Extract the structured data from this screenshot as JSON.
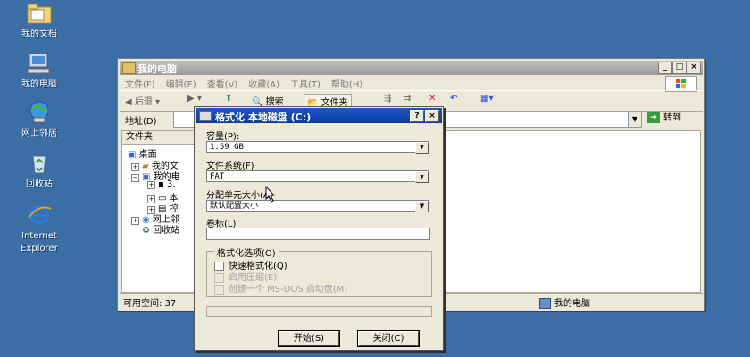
{
  "desktop": {
    "icons": [
      {
        "label": "我的文档"
      },
      {
        "label": "我的电脑"
      },
      {
        "label": "网上邻居"
      },
      {
        "label": "回收站"
      },
      {
        "label": "Internet\nExplorer"
      }
    ]
  },
  "explorer": {
    "title": "我的电脑",
    "menu": [
      "文件(F)",
      "编辑(E)",
      "查看(V)",
      "收藏(A)",
      "工具(T)",
      "帮助(H)"
    ],
    "toolbar": {
      "back": "后退",
      "search": "搜索",
      "folders": "文件夹"
    },
    "address_label": "地址(D)",
    "go_label": "转到",
    "folder_pane_header": "文件夹",
    "tree": {
      "desktop": "桌面",
      "my_docs": "我的文",
      "my_computer": "我的电",
      "item_3": "3.",
      "item_local": "本",
      "item_control": "控",
      "network": "网上邻",
      "recycle": "回收站"
    },
    "status_left": "可用空间: 37",
    "status_right": "我的电脑"
  },
  "dialog": {
    "title": "格式化 本地磁盘 (C:)",
    "capacity_label": "容量(P):",
    "capacity_value": "1.59 GB",
    "filesystem_label": "文件系统(F)",
    "filesystem_value": "FAT",
    "alloc_label": "分配单元大小(A)",
    "alloc_value": "默认配置大小",
    "volume_label": "卷标(L)",
    "volume_value": "",
    "options_group": "格式化选项(O)",
    "opt_quick": "快速格式化(Q)",
    "opt_compress": "启用压缩(E)",
    "opt_msdos": "创建一个 MS-DOS 启动盘(M)",
    "start_label": "开始(S)",
    "close_label": "关闭(C)"
  },
  "colors": {
    "desktop": "#3a6ea5",
    "dialog_title": "#0a3aa8"
  }
}
